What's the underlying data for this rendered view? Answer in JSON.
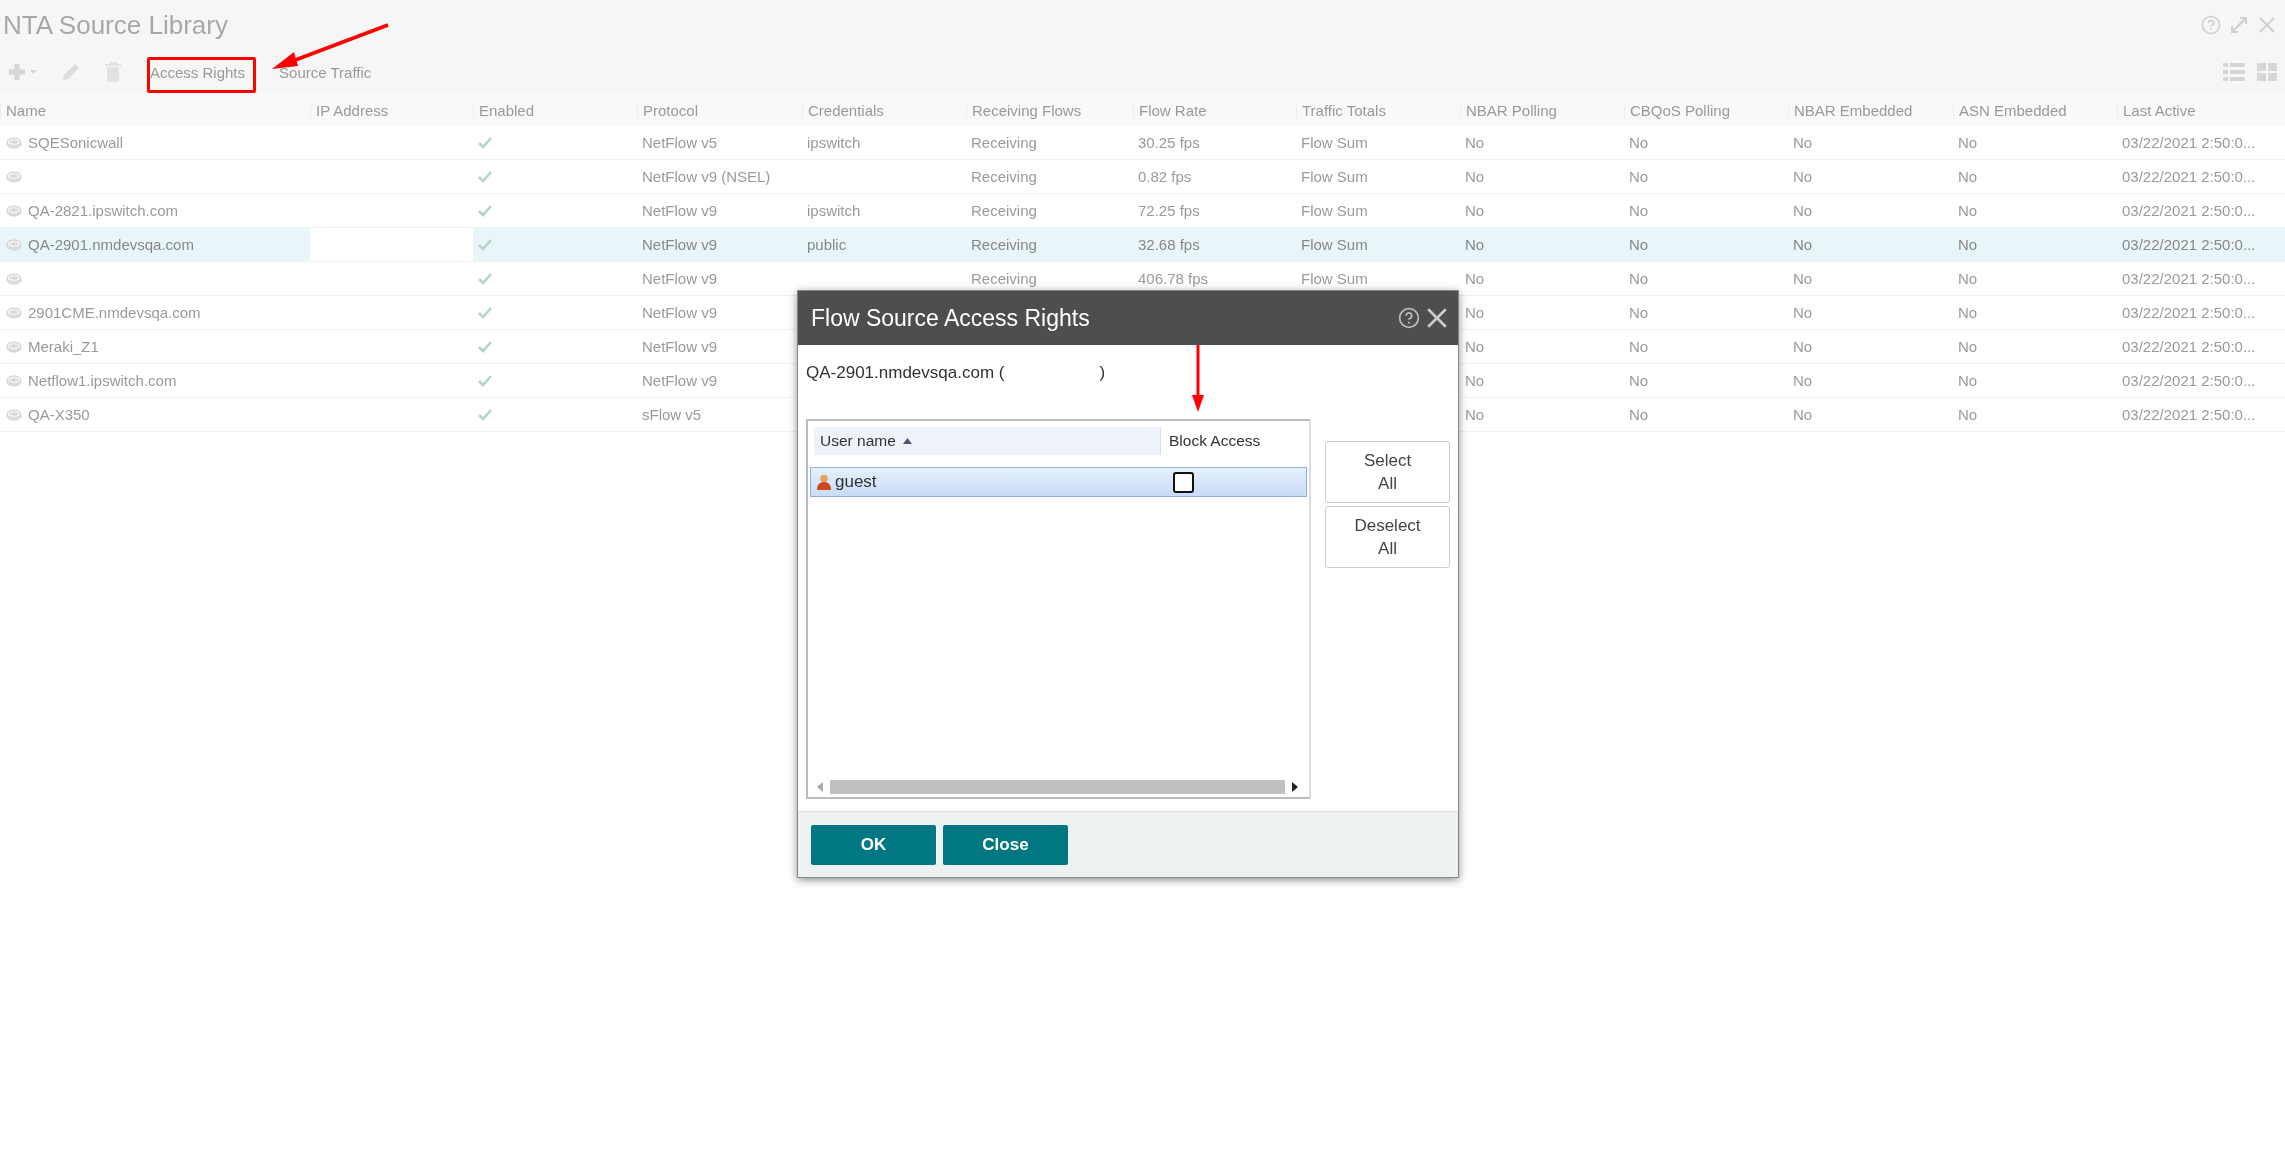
{
  "window": {
    "title": "NTA Source Library"
  },
  "toolbar": {
    "actions": [
      "Access Rights",
      "Source Traffic"
    ]
  },
  "table": {
    "columns": [
      "Name",
      "IP Address",
      "Enabled",
      "Protocol",
      "Credentials",
      "Receiving Flows",
      "Flow Rate",
      "Traffic Totals",
      "NBAR Polling",
      "CBQoS Polling",
      "NBAR Embedded",
      "ASN Embedded",
      "Last Active"
    ],
    "rows": [
      {
        "selected": false,
        "enabled": true,
        "cells": {
          "name": "SQESonicwall",
          "protocol": "NetFlow v5",
          "credentials": "ipswitch",
          "receiving": "Receiving",
          "rate": "30.25 fps",
          "totals": "Flow Sum",
          "nbar_polling": "No",
          "cbqos": "No",
          "nbar_embedded": "No",
          "asn": "No",
          "last_active": "03/22/2021 2:50:0..."
        }
      },
      {
        "selected": false,
        "enabled": true,
        "cells": {
          "protocol": "NetFlow v9 (NSEL)",
          "receiving": "Receiving",
          "rate": "0.82 fps",
          "totals": "Flow Sum",
          "nbar_polling": "No",
          "cbqos": "No",
          "nbar_embedded": "No",
          "asn": "No",
          "last_active": "03/22/2021 2:50:0..."
        }
      },
      {
        "selected": false,
        "enabled": true,
        "cells": {
          "name": "QA-2821.ipswitch.com",
          "protocol": "NetFlow v9",
          "credentials": "ipswitch",
          "receiving": "Receiving",
          "rate": "72.25 fps",
          "totals": "Flow Sum",
          "nbar_polling": "No",
          "cbqos": "No",
          "nbar_embedded": "No",
          "asn": "No",
          "last_active": "03/22/2021 2:50:0..."
        }
      },
      {
        "selected": true,
        "enabled": true,
        "cells": {
          "name": "QA-2901.nmdevsqa.com",
          "protocol": "NetFlow v9",
          "credentials": "public",
          "receiving": "Receiving",
          "rate": "32.68 fps",
          "totals": "Flow Sum",
          "nbar_polling": "No",
          "cbqos": "No",
          "nbar_embedded": "No",
          "asn": "No",
          "last_active": "03/22/2021 2:50:0..."
        }
      },
      {
        "selected": false,
        "enabled": true,
        "cells": {
          "protocol": "NetFlow v9",
          "receiving": "Receiving",
          "rate": "406.78 fps",
          "totals": "Flow Sum",
          "nbar_polling": "No",
          "cbqos": "No",
          "nbar_embedded": "No",
          "asn": "No",
          "last_active": "03/22/2021 2:50:0..."
        }
      },
      {
        "selected": false,
        "enabled": true,
        "cells": {
          "name": "2901CME.nmdevsqa.com",
          "protocol": "NetFlow v9",
          "nbar_polling": "No",
          "cbqos": "No",
          "nbar_embedded": "No",
          "asn": "No",
          "last_active": "03/22/2021 2:50:0..."
        }
      },
      {
        "selected": false,
        "enabled": true,
        "cells": {
          "name": "Meraki_Z1",
          "protocol": "NetFlow v9",
          "nbar_polling": "No",
          "cbqos": "No",
          "nbar_embedded": "No",
          "asn": "No",
          "last_active": "03/22/2021 2:50:0..."
        }
      },
      {
        "selected": false,
        "enabled": true,
        "cells": {
          "name": "Netflow1.ipswitch.com",
          "protocol": "NetFlow v9",
          "nbar_polling": "No",
          "cbqos": "No",
          "nbar_embedded": "No",
          "asn": "No",
          "last_active": "03/22/2021 2:50:0..."
        }
      },
      {
        "selected": false,
        "enabled": true,
        "cells": {
          "name": "QA-X350",
          "protocol": "sFlow v5",
          "nbar_polling": "No",
          "cbqos": "No",
          "nbar_embedded": "No",
          "asn": "No",
          "last_active": "03/22/2021 2:50:0..."
        }
      }
    ]
  },
  "dialog": {
    "title": "Flow Source Access Rights",
    "source_name": "QA-2901.nmdevsqa.com (",
    "source_close": ")",
    "grid": {
      "columns": [
        "User name",
        "Block Access"
      ],
      "sorted_ascending": true,
      "rows": [
        {
          "user": "guest",
          "selected": true,
          "block_access": false
        }
      ]
    },
    "side_buttons": [
      [
        "Select",
        "All"
      ],
      [
        "Deselect",
        "All"
      ]
    ],
    "buttons": [
      "OK",
      "Close"
    ]
  }
}
